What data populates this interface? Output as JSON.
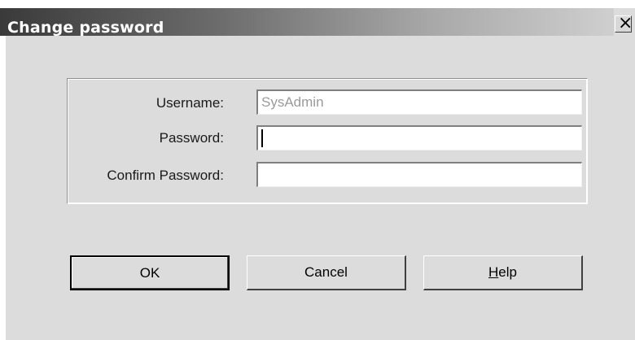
{
  "dialog": {
    "title": "Change password",
    "close_glyph": "✕"
  },
  "form": {
    "username": {
      "label": "Username:",
      "value": "SysAdmin"
    },
    "password": {
      "label": "Password:",
      "value": ""
    },
    "confirm": {
      "label": "Confirm Password:",
      "value": ""
    }
  },
  "buttons": {
    "ok": "OK",
    "cancel": "Cancel",
    "help_mnemonic": "H",
    "help_rest": "elp"
  },
  "icons": {
    "close": "close-icon"
  }
}
